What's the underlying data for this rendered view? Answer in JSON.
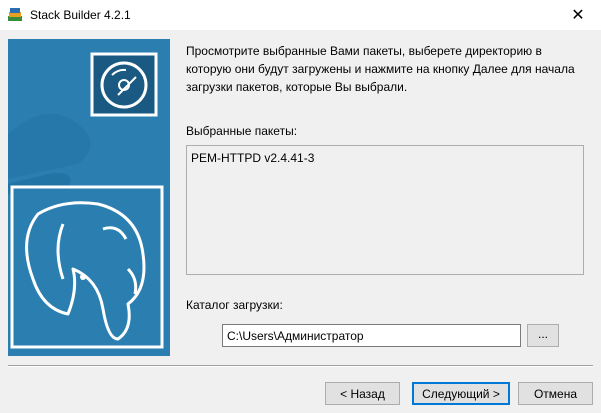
{
  "window": {
    "title": "Stack Builder 4.2.1",
    "close_glyph": "✕"
  },
  "intro_text": "Просмотрите выбранные Вами пакеты, выберете директорию в которую они будут загружены и нажмите на кнопку Далее для начала загрузки пакетов, которые Вы выбрали.",
  "packages": {
    "label": "Выбранные пакеты:",
    "items": [
      "PEM-HTTPD v2.4.41-3"
    ]
  },
  "download_dir": {
    "label": "Каталог загрузки:",
    "value": "C:\\Users\\Администратор",
    "browse_label": "..."
  },
  "buttons": {
    "back": "< Назад",
    "next": "Следующий >",
    "cancel": "Отмена"
  },
  "colors": {
    "banner": "#2a7fb0",
    "accent": "#0078d7"
  },
  "icons": {
    "app": "stack-builder-icon",
    "disc": "disc-icon",
    "banner_logo": "postgresql-elephant-icon"
  }
}
